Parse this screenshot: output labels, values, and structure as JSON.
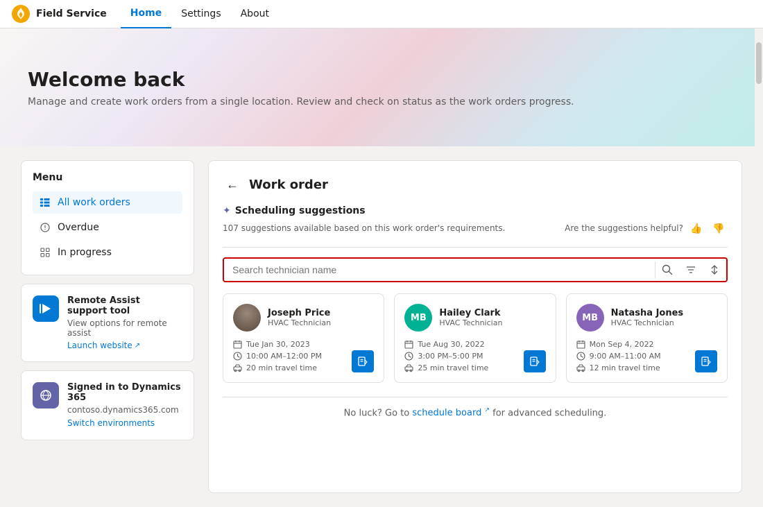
{
  "app": {
    "brand": "Field Service",
    "nav_links": [
      {
        "id": "home",
        "label": "Home",
        "active": true
      },
      {
        "id": "settings",
        "label": "Settings",
        "active": false
      },
      {
        "id": "about",
        "label": "About",
        "active": false
      }
    ]
  },
  "hero": {
    "title": "Welcome back",
    "subtitle": "Manage and create work orders from a single location. Review and check on status as the work orders progress."
  },
  "menu": {
    "title": "Menu",
    "items": [
      {
        "id": "all-work-orders",
        "label": "All work orders",
        "active": true
      },
      {
        "id": "overdue",
        "label": "Overdue",
        "active": false
      },
      {
        "id": "in-progress",
        "label": "In progress",
        "active": false
      }
    ]
  },
  "remote_assist": {
    "title": "Remote Assist support tool",
    "description": "View options for remote assist",
    "link_label": "Launch website"
  },
  "dynamics": {
    "title": "Signed in to Dynamics 365",
    "description": "contoso.dynamics365.com",
    "link_label": "Switch environments"
  },
  "work_order": {
    "title": "Work order",
    "scheduling": {
      "title": "Scheduling suggestions",
      "count": "107",
      "meta": "107 suggestions available based on this work order's requirements.",
      "helpful_label": "Are the suggestions helpful?"
    },
    "search": {
      "placeholder": "Search technician name"
    },
    "technicians": [
      {
        "id": "joseph-price",
        "name": "Joseph Price",
        "role": "HVAC Technician",
        "avatar_type": "photo",
        "initials": "",
        "date": "Tue Jan 30, 2023",
        "time": "10:00 AM–12:00 PM",
        "travel": "20 min travel time"
      },
      {
        "id": "hailey-clark",
        "name": "Hailey Clark",
        "role": "HVAC Technician",
        "avatar_type": "teal",
        "initials": "MB",
        "date": "Tue Aug 30, 2022",
        "time": "3:00 PM–5:00 PM",
        "travel": "25 min travel time"
      },
      {
        "id": "natasha-jones",
        "name": "Natasha Jones",
        "role": "HVAC Technician",
        "avatar_type": "purple",
        "initials": "MB",
        "date": "Mon Sep 4, 2022",
        "time": "9:00 AM–11:00 AM",
        "travel": "12 min travel time"
      }
    ],
    "footer": {
      "text_before": "No luck? Go to ",
      "link_label": "schedule board",
      "text_after": " for advanced scheduling."
    }
  }
}
